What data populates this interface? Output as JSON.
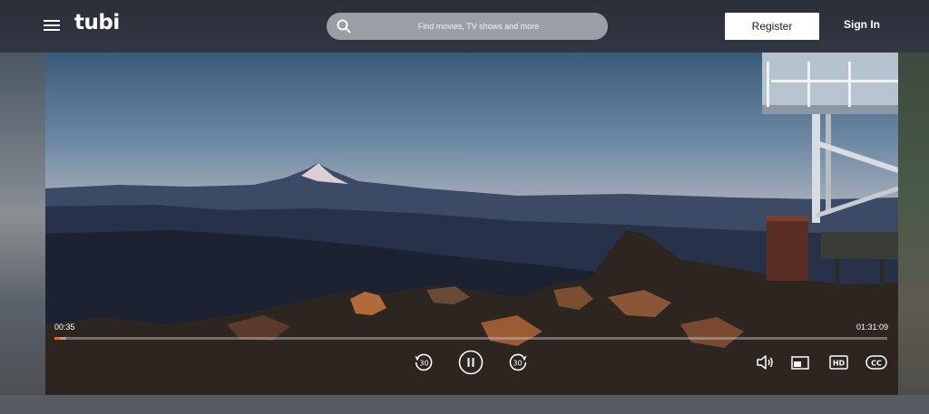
{
  "header": {
    "logo_text": "tubi",
    "search": {
      "placeholder": "Find movies, TV shows and more"
    },
    "register_label": "Register",
    "signin_label": "Sign In"
  },
  "player": {
    "current_time": "00:35",
    "total_time": "01:31:09",
    "progress_fraction": 0.0064,
    "buffered_fraction": 0.014,
    "rewind_label": "30",
    "forward_label": "30",
    "hd_label": "HD",
    "cc_label": "CC",
    "accent_color": "#ff5a1f"
  },
  "icons": [
    "menu-icon",
    "search-icon",
    "rewind-30-icon",
    "pause-icon",
    "forward-30-icon",
    "volume-icon",
    "pip-icon",
    "hd-icon",
    "cc-icon"
  ]
}
